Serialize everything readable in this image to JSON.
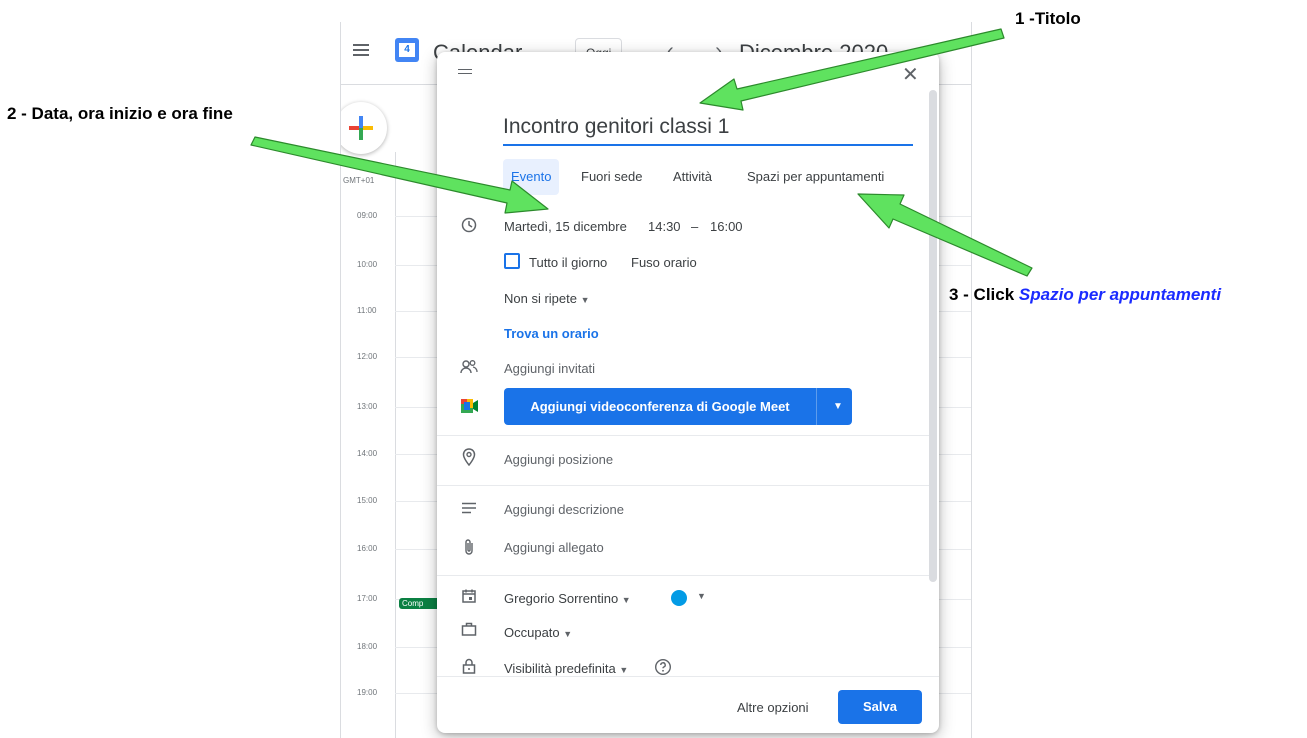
{
  "annotations": {
    "a1": "1 -Titolo",
    "a2": "2 - Data, ora inizio e ora fine",
    "a3_prefix": "3 - Click ",
    "a3_link": "Spazio per appuntamenti"
  },
  "calendar": {
    "logo_day": "4",
    "app_title": "Calendar",
    "today": "Oggi",
    "nav": "‹ ›",
    "month": "Dicembre 2020",
    "gmt": "GMT+01",
    "hours": [
      "09:00",
      "10:00",
      "11:00",
      "12:00",
      "13:00",
      "14:00",
      "15:00",
      "16:00",
      "17:00",
      "18:00",
      "19:00"
    ],
    "event_chip": "Comp"
  },
  "dialog": {
    "title_value": "Incontro genitori classi 1",
    "tabs": [
      "Evento",
      "Fuori sede",
      "Attività",
      "Spazi per appuntamenti"
    ],
    "date": "Martedì, 15 dicembre",
    "time_start": "14:30",
    "time_dash": "–",
    "time_end": "16:00",
    "all_day": "Tutto il giorno",
    "timezone": "Fuso orario",
    "repeat": "Non si ripete",
    "find_time": "Trova un orario",
    "guests": "Aggiungi invitati",
    "meet": "Aggiungi videoconferenza di Google Meet",
    "location": "Aggiungi posizione",
    "description": "Aggiungi descrizione",
    "attachment": "Aggiungi allegato",
    "calendar_owner": "Gregorio Sorrentino",
    "busy": "Occupato",
    "visibility": "Visibilità predefinita",
    "more_options": "Altre opzioni",
    "save": "Salva"
  },
  "colors": {
    "accent": "#1a73e8",
    "annotation_arrow": "#5fe25f",
    "annotation_link": "#1a2bff",
    "event_color": "#039be5"
  }
}
